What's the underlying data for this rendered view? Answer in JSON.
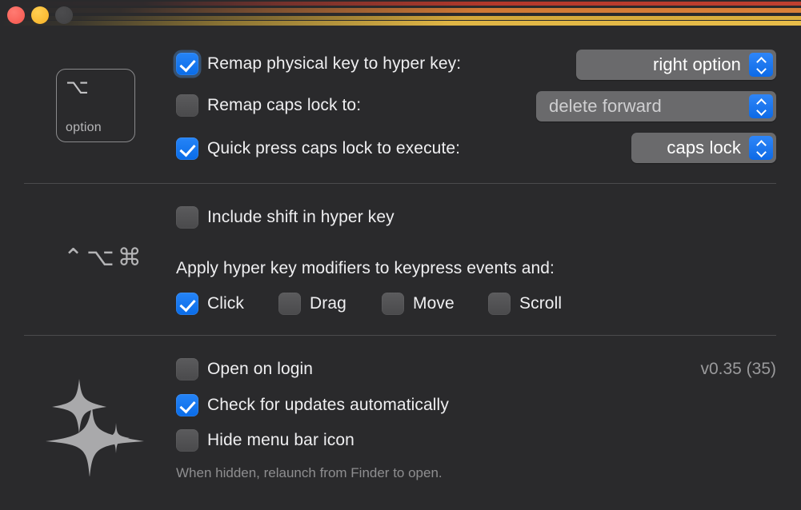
{
  "window": {
    "traffic_lights": [
      {
        "name": "close",
        "color": "#f5564d",
        "enabled": true
      },
      {
        "name": "minimize",
        "color": "#f7b125",
        "enabled": true
      },
      {
        "name": "zoom",
        "color": "#414143",
        "enabled": false
      }
    ]
  },
  "decor": {
    "stripe_colors": [
      "#b4382b",
      "#cf7834",
      "#d3a73a",
      "#dfb545"
    ]
  },
  "section_one": {
    "key_cap": {
      "glyph": "⌥",
      "name": "option"
    },
    "rows": [
      {
        "id": "remap-physical-key",
        "label": "Remap physical key to hyper key:",
        "checked": true,
        "focused": true
      },
      {
        "id": "remap-caps-lock",
        "label": "Remap caps lock to:",
        "checked": false,
        "focused": false
      },
      {
        "id": "quick-press-caps-lock",
        "label": "Quick press caps lock to execute:",
        "checked": true,
        "focused": false
      }
    ],
    "popups": [
      {
        "id": "hyper-key",
        "value": "right option",
        "enabled": true
      },
      {
        "id": "caps-lock-remap",
        "value": "delete forward",
        "enabled": false
      },
      {
        "id": "quick-press",
        "value": "caps lock",
        "enabled": true
      }
    ]
  },
  "section_two": {
    "modifier_glyphs": "⌃⌥⌘",
    "include_shift": {
      "label": "Include shift in hyper key",
      "checked": false
    },
    "apply_heading": "Apply hyper key modifiers to keypress events and:",
    "event_toggles": [
      {
        "id": "click",
        "label": "Click",
        "checked": true
      },
      {
        "id": "drag",
        "label": "Drag",
        "checked": false
      },
      {
        "id": "move",
        "label": "Move",
        "checked": false
      },
      {
        "id": "scroll",
        "label": "Scroll",
        "checked": false
      }
    ]
  },
  "section_three": {
    "app_icon": "sparkles-icon",
    "version": "v0.35 (35)",
    "rows": [
      {
        "id": "open-on-login",
        "label": "Open on login",
        "checked": false
      },
      {
        "id": "check-updates",
        "label": "Check for updates automatically",
        "checked": true
      },
      {
        "id": "hide-menu-bar",
        "label": "Hide menu bar icon",
        "checked": false
      }
    ],
    "hint": "When hidden, relaunch from Finder to open."
  }
}
